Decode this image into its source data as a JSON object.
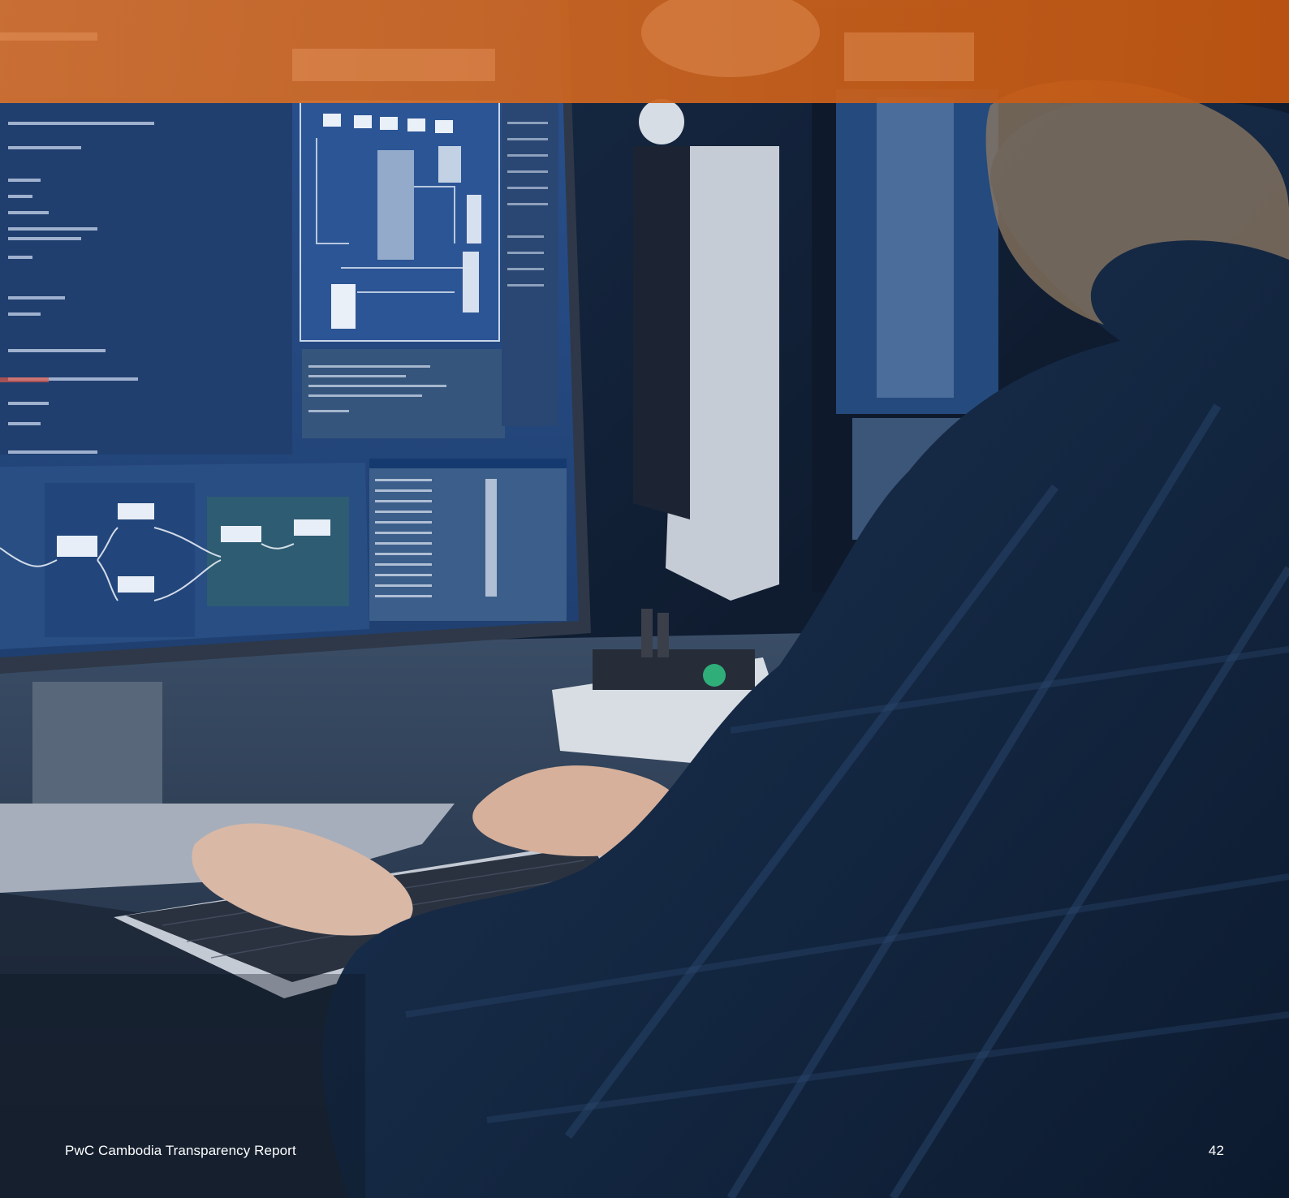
{
  "footer": {
    "report_title": "PwC Cambodia Transparency Report",
    "page_number": "42"
  },
  "photo": {
    "subject": "person-typing-at-workstation-with-monitors",
    "icon": "photograph-icon"
  },
  "colors": {
    "band_orange": "#d0651f",
    "band_orange_dark": "#c65a12",
    "scene_navy": "#0d1a2c",
    "screen_blue": "#274d86",
    "footer_text": "#ffffff"
  }
}
